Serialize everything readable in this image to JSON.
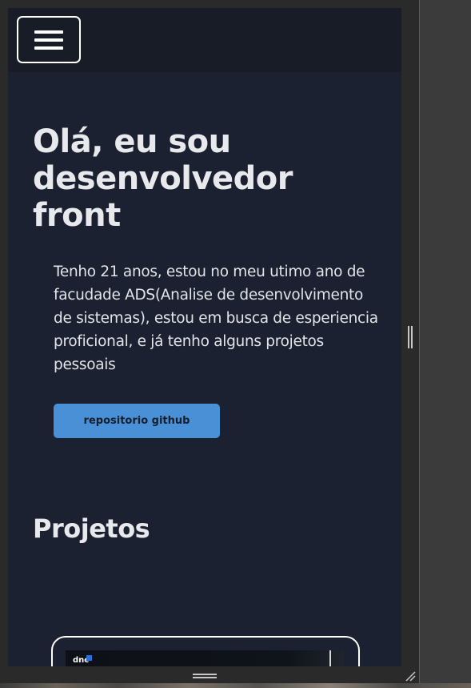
{
  "header": {
    "menu_icon": "hamburger-menu-icon"
  },
  "hero": {
    "title": "Olá, eu sou desenvolvedor front",
    "description": "Tenho 21 anos, estou no meu utimo ano de facudade ADS(Analise de desenvolvimento de sistemas), estou em busca de esperiencia proficional, e já tenho alguns projetos pessoais",
    "button_label": "repositorio github"
  },
  "projects": {
    "title": "Projetos",
    "card_logo": "dnc"
  },
  "colors": {
    "page_background": "#1b2130",
    "header_background": "#171c26",
    "button_accent": "#4a90d6",
    "text": "#e8e9ec"
  }
}
